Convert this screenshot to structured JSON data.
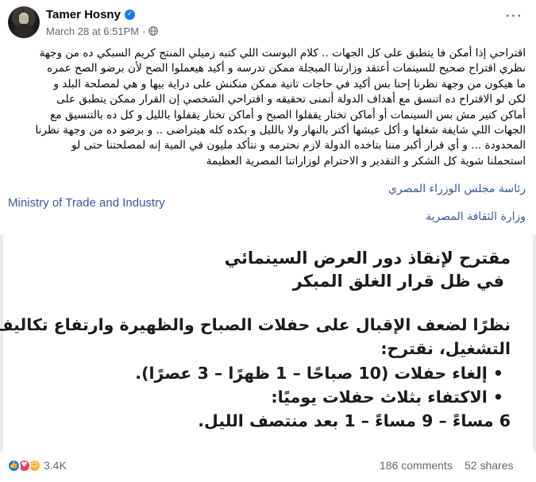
{
  "post": {
    "author": "Tamer Hosny",
    "timestamp": "March 28 at 6:51PM",
    "separator": "·",
    "privacy_icon": "globe-icon",
    "more_icon": "more-options-icon",
    "text_lines": [
      "اقتراحي إذا أمكن فا يتطبق على كل الجهات .. كلام البوست اللي كتبه زميلي المنتج كريم السبكي ده من وجهة",
      "نظري اقتراح صحيح للسينمات أعتقد وزارتنا المبجلة ممكن تدرسه و أكيد هيعملوا الصح لأن برضو الصح عمره",
      "ما هيكون من وجهة نظرنا إحنا بس أكيد في حاجات تانية ممكن منكنش على دراية بيها و هي لمصلحة البلد و",
      "لكن لو الاقتراح ده اتنسق مع أهداف الدولة أتمنى تحقيقه و اقتراحي الشخصي إن القرار ممكن يتطبق على",
      "أماكن كتير مش بس السينمات  أو أماكن تختار يقفلوا الصبح و أماكن تختار يقفلوا بالليل و كل ده بالتنسيق مع",
      "الجهات اللي شايفة شغلها و أكل عيشها أكتر بالنهار ولا بالليل و بكده كله هيتراضى .. و برضو ده من وجهة نظرنا",
      "المحدودة ... و أي قرار أكبر مننا بتاخده الدولة لازم نحترمه و نتأكد مليون في المية إنه لمصلحتنا حتى لو",
      "استحملنا شوية  كل الشكر و التقدير و الاحترام لوزاراتنا المصرية العظيمة"
    ],
    "tags": [
      "رئاسة مجلس الوزراء المصري",
      "Ministry of Trade and Industry",
      "وزارة الثقافة المصرية"
    ]
  },
  "image": {
    "lines": [
      "مقترح لإنقاذ دور العرض السينمائي",
      "في ظل قرار الغلق المبكر",
      "نظرًا لضعف الإقبال على حفلات الصباح والظهيرة وارتفاع تكاليف",
      "التشغيل، نقترح:",
      "• إلغاء حفلات (10 صباحًا – 1 ظهرًا – 3 عصرًا).",
      "• الاكتفاء بثلاث حفلات يوميًا:",
      "6 مساءً – 9 مساءً – 1 بعد منتصف الليل."
    ]
  },
  "stats": {
    "reaction_icons": [
      "like-icon",
      "love-icon",
      "care-icon"
    ],
    "reaction_count": "3.4K",
    "comments": "186 comments",
    "shares": "52 shares"
  },
  "colors": {
    "link": "#385898",
    "meta": "#65676b",
    "verified": "#1877f2"
  }
}
